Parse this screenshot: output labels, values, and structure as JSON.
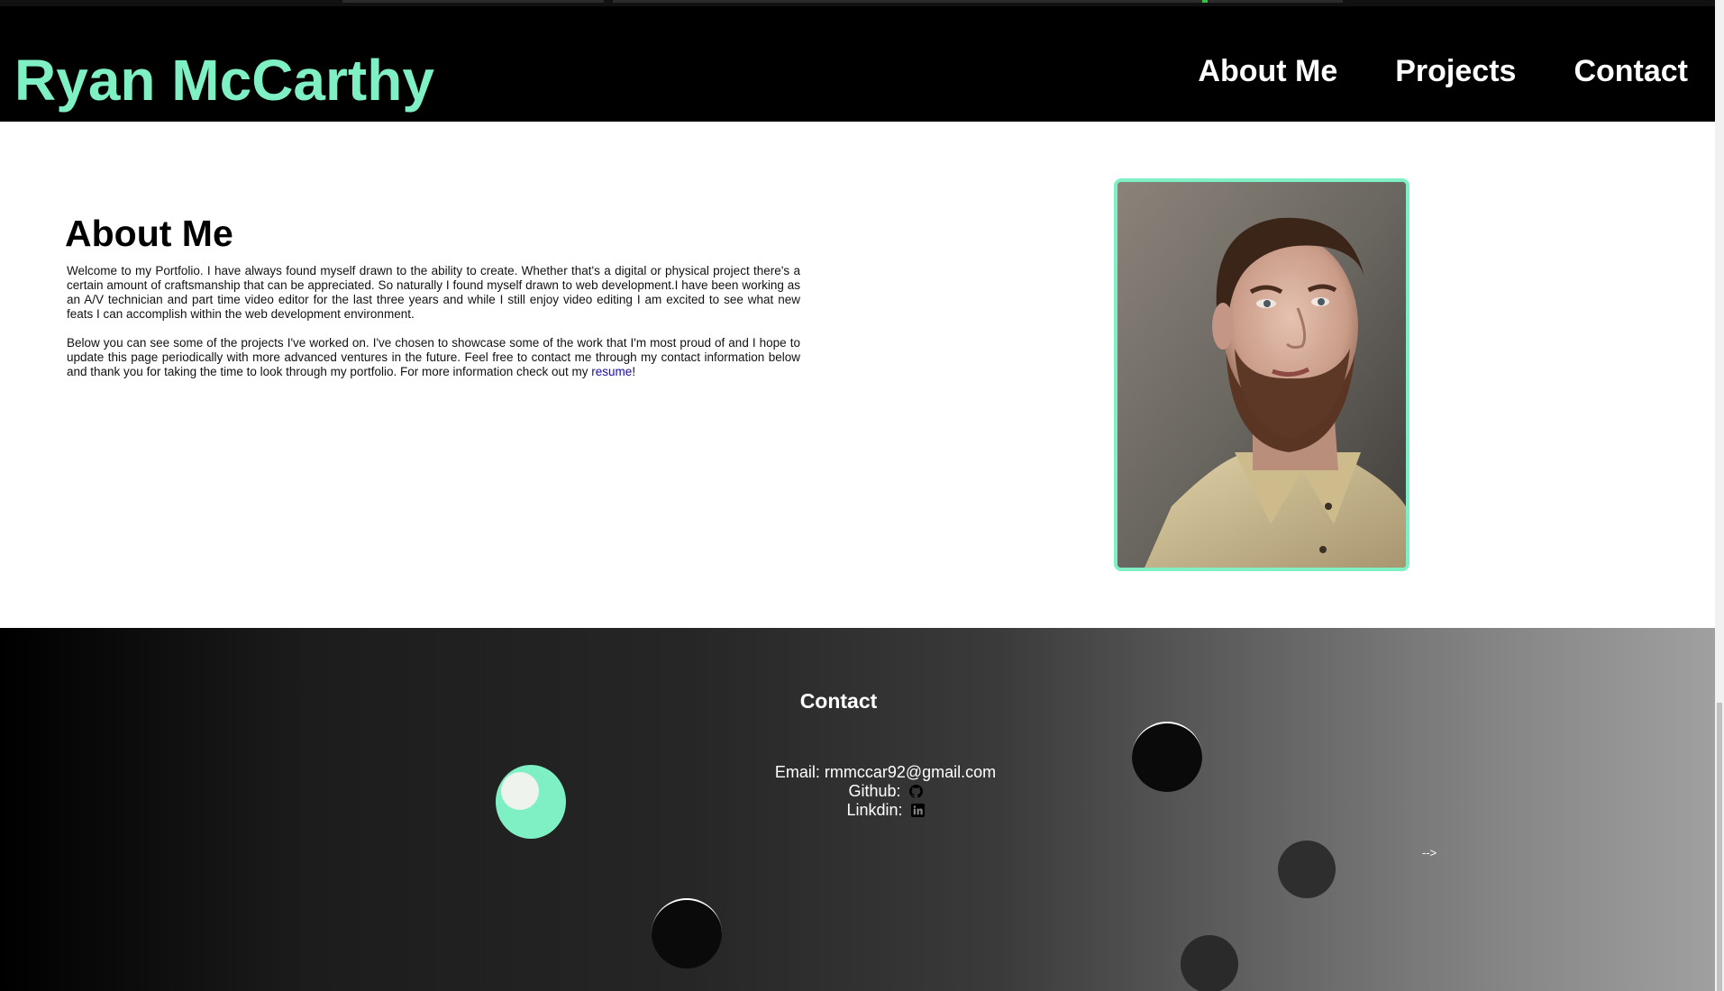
{
  "header": {
    "title": "Ryan McCarthy",
    "nav": [
      "About Me",
      "Projects",
      "Contact"
    ]
  },
  "about": {
    "heading": "About Me",
    "paragraph1": "Welcome to my Portfolio. I have always found myself drawn to the ability to create. Whether that's a digital or physical project there's a certain amount of craftsmanship that can be appreciated. So naturally I found myself drawn to web development.I have been working as an A/V technician and part time video editor for the last three years and while I still enjoy video editing I am excited to see what new feats I can accomplish within the web development environment.",
    "paragraph2": "Below you can see some of the projects I've worked on. I've chosen to showcase some of the work that I'm most proud of and I hope to update this page periodically with more advanced ventures in the future. Feel free to contact me through my contact information below and thank you for taking the time to look through my portfolio. For more information check out my",
    "resume_link": "resume",
    "paragraph2_end": "!"
  },
  "contact": {
    "heading": "Contact",
    "email_label": "Email:",
    "email_value": "rmmccar92@gmail.com",
    "github_label": "Github:",
    "linkedin_label": "Linkdin:",
    "stray_text": "-->"
  },
  "colors": {
    "accent": "#7ff0c4",
    "header_bg": "#000000",
    "link": "#1a0dab"
  },
  "icons": {
    "github": "github-icon",
    "linkedin": "linkedin-icon"
  }
}
